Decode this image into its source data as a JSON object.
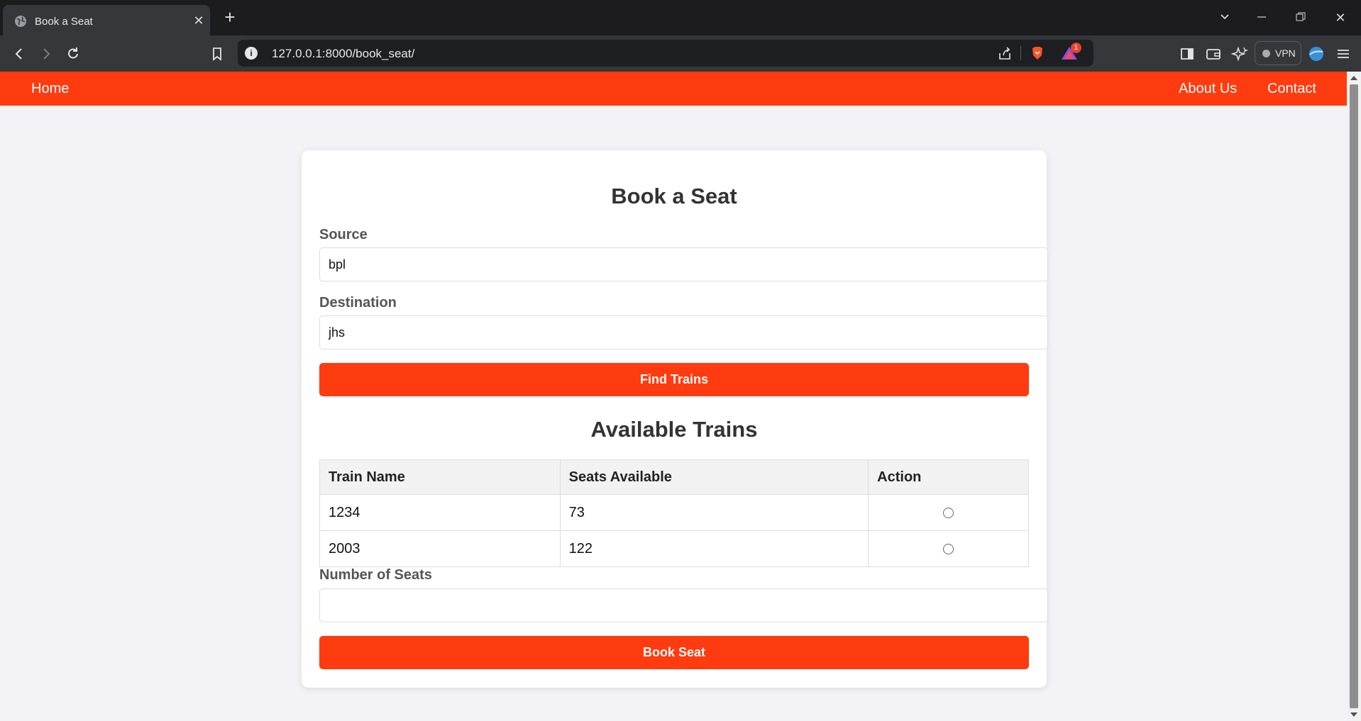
{
  "browser": {
    "tab_title": "Book a Seat",
    "url": "127.0.0.1:8000/book_seat/",
    "notification_count": "1",
    "vpn_label": "VPN"
  },
  "nav": {
    "home": "Home",
    "about": "About Us",
    "contact": "Contact"
  },
  "form": {
    "title": "Book a Seat",
    "source_label": "Source",
    "source_value": "bpl",
    "destination_label": "Destination",
    "destination_value": "jhs",
    "find_button": "Find Trains",
    "trains_title": "Available Trains",
    "columns": [
      "Train Name",
      "Seats Available",
      "Action"
    ],
    "rows": [
      {
        "train": "1234",
        "seats": "73"
      },
      {
        "train": "2003",
        "seats": "122"
      }
    ],
    "seats_label": "Number of Seats",
    "seats_value": "",
    "book_button": "Book Seat"
  },
  "colors": {
    "accent": "#ff3b0f",
    "page_bg": "#f3f3f7"
  }
}
